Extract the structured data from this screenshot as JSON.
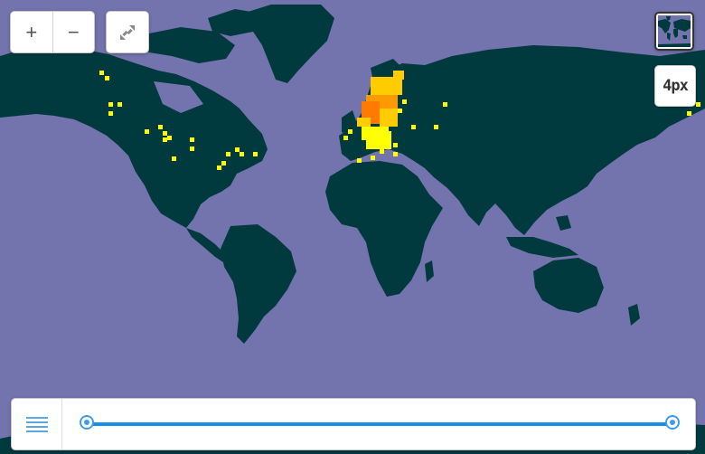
{
  "map": {
    "ocean_color": "#7373ad",
    "land_color": "#003a3f",
    "heat_colors": [
      "#ffff00",
      "#ffcc00",
      "#ff9900",
      "#ff7a00"
    ]
  },
  "controls": {
    "zoom_in_label": "+",
    "zoom_out_label": "−",
    "fullscreen_icon": "fullscreen-collapse-icon",
    "layer_icon": "world-map-thumbnail-icon",
    "resolution_label": "4px"
  },
  "timebar": {
    "menu_icon": "hamburger-menu-icon",
    "accent_color": "#1a8fe8",
    "range_start": 0,
    "range_end": 1
  }
}
